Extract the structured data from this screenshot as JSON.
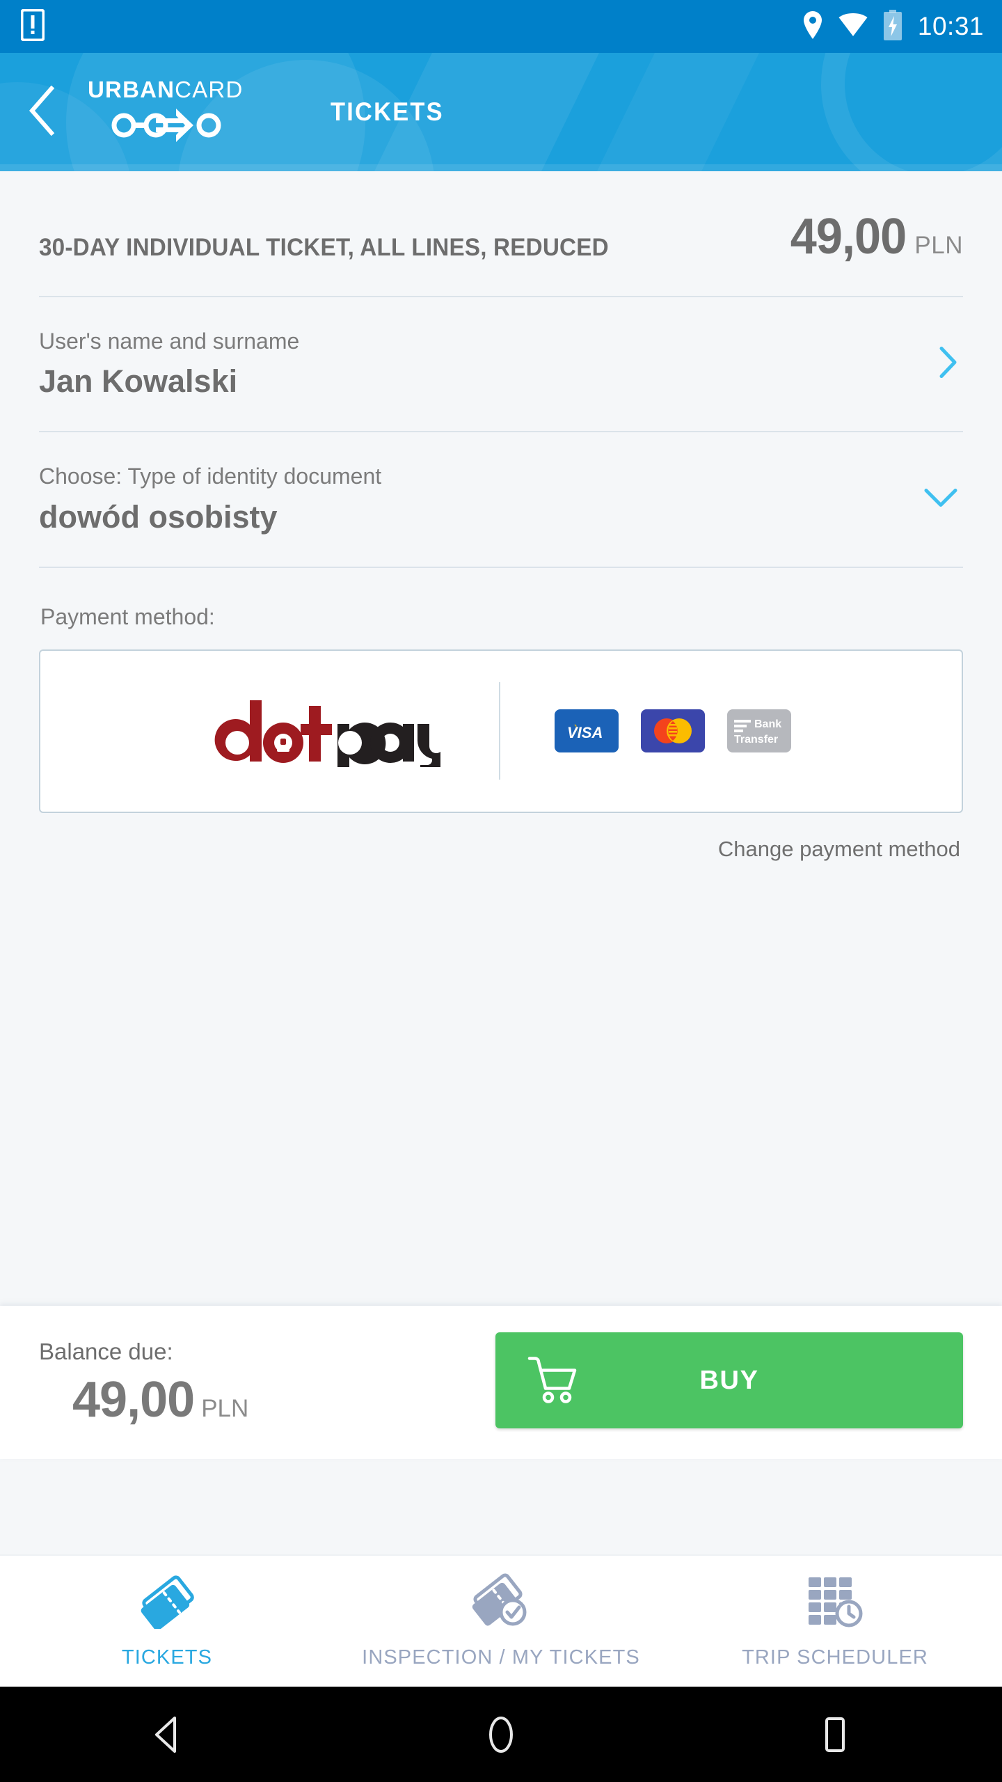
{
  "status_bar": {
    "time": "10:31",
    "icons": [
      "notification-icon",
      "location-icon",
      "wifi-icon",
      "battery-charging-icon"
    ]
  },
  "app_bar": {
    "back_label": "back",
    "brand_bold": "URBAN",
    "brand_light": "CARD",
    "title": "TICKETS"
  },
  "ticket": {
    "name": "30-DAY INDIVIDUAL TICKET, ALL LINES, REDUCED",
    "price": "49,00",
    "currency": "PLN"
  },
  "user_field": {
    "label": "User's name and surname",
    "value": "Jan Kowalski"
  },
  "document_field": {
    "label": "Choose: Type of identity document",
    "value": "dowód osobisty"
  },
  "payment": {
    "label": "Payment method:",
    "provider": "dotpay",
    "provider_dot": "dot",
    "provider_pay": "pay",
    "badges": [
      {
        "name": "visa",
        "text": "VISA"
      },
      {
        "name": "mastercard",
        "text": ""
      },
      {
        "name": "bank-transfer",
        "line1": "Bank",
        "line2": "Transfer"
      }
    ],
    "change_link": "Change payment method"
  },
  "balance": {
    "label": "Balance due:",
    "amount": "49,00",
    "currency": "PLN"
  },
  "buy_button": {
    "label": "BUY"
  },
  "bottom_nav": [
    {
      "label": "TICKETS",
      "icon": "tickets-icon",
      "active": true
    },
    {
      "label": "INSPECTION / MY TICKETS",
      "icon": "inspection-ticket-check-icon",
      "active": false
    },
    {
      "label": "TRIP SCHEDULER",
      "icon": "grid-clock-icon",
      "active": false
    }
  ],
  "android_nav": {
    "back": "back",
    "home": "home",
    "recents": "recents"
  },
  "colors": {
    "status_bar": "#0080c9",
    "app_bar": "#1ba0dc",
    "accent": "#29a8e0",
    "buy_green": "#4cc463",
    "page_bg": "#f5f7f9",
    "text_gray": "#6d6d6d",
    "nav_inactive": "#99a6c0"
  }
}
